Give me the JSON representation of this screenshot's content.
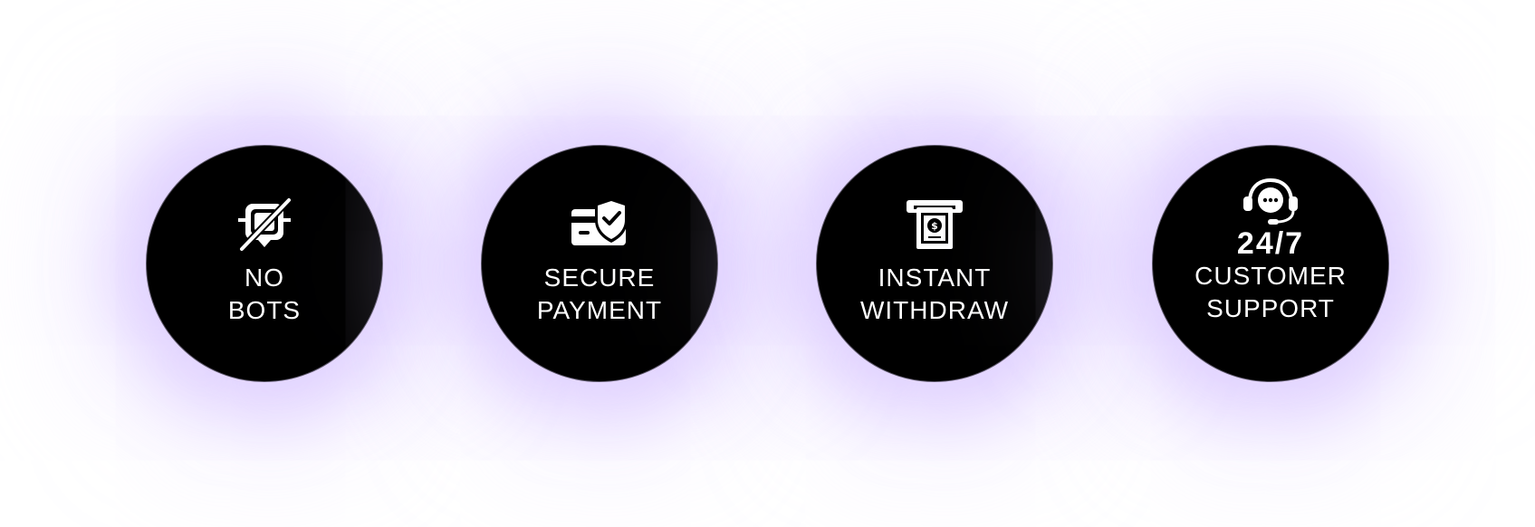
{
  "features": [
    {
      "icon": "no-bots-icon",
      "line1": "NO",
      "line2": "BOTS"
    },
    {
      "icon": "secure-card-shield-icon",
      "line1": "SECURE",
      "line2": "PAYMENT"
    },
    {
      "icon": "atm-cash-withdraw-icon",
      "line1": "INSTANT",
      "line2": "WITHDRAW"
    },
    {
      "icon": "headset-chat-support-icon",
      "highlight": "24/7",
      "line1": "CUSTOMER",
      "line2": "SUPPORT"
    }
  ],
  "colors": {
    "circle": "#000000",
    "text": "#ffffff",
    "glow": "#ceb6ff",
    "background": "#ffffff"
  }
}
